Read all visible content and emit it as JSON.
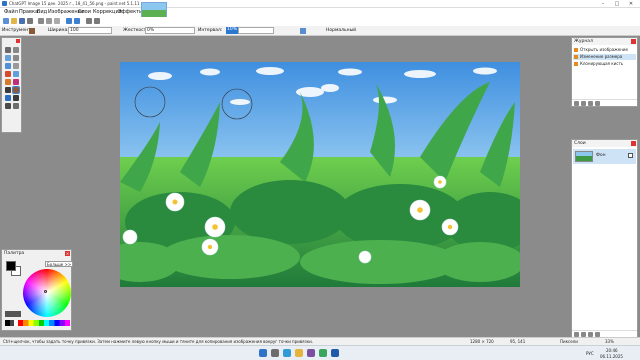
{
  "window": {
    "title": "ChatGPT Image 15 дек. 2025 г., 18_41_56.png - paint.net 5.1.11"
  },
  "menu": {
    "file": "Файл",
    "edit": "Правка",
    "view": "Вид",
    "image": "Изображение",
    "layers": "Слои",
    "adjustments": "Коррекция",
    "effects": "Эффекты"
  },
  "options": {
    "tool_label": "Инструмент:",
    "width_label": "Ширина:",
    "width_value": "100",
    "hardness_label": "Жесткость:",
    "hardness_value": "0%",
    "interval_label": "Интервал:",
    "interval_value": "10%",
    "blend_mode": "Нормальный"
  },
  "palette": {
    "title": "Палитра",
    "more_button": "Больше >>",
    "primary_color": "#000000",
    "secondary_color": "#ffffff"
  },
  "history": {
    "title": "Журнал",
    "items": [
      {
        "label": "Открыть изображение",
        "selected": false
      },
      {
        "label": "Изменение размера",
        "selected": true
      },
      {
        "label": "Клонирующая кисть",
        "selected": false
      }
    ]
  },
  "layers": {
    "title": "Слои",
    "items": [
      {
        "name": "Фон",
        "visible": true
      }
    ]
  },
  "status": {
    "hint": "Ctrl+щелчок, чтобы задать точку привязки. Затем нажмите левую кнопку мыши и тяните для копирования изображения вокруг точки привязки.",
    "image_size": "1280 × 720",
    "cursor_pos": "95, 141",
    "units": "Пиксели",
    "zoom": "33%"
  },
  "taskbar": {
    "lang": "РУС",
    "time": "20:46",
    "date": "06.11.2025"
  },
  "icons": [
    "app-icon",
    "minimize-icon",
    "maximize-icon",
    "close-icon",
    "new-icon",
    "open-icon",
    "save-icon",
    "print-icon",
    "cut-icon",
    "copy-icon",
    "paste-icon",
    "undo-icon",
    "redo-icon",
    "grid-icon",
    "settings-icon",
    "clone-stamp-icon",
    "brush-icon",
    "eraser-icon",
    "bucket-icon",
    "gradient-icon",
    "text-icon",
    "windows-start-icon",
    "search-icon",
    "edge-icon",
    "explorer-icon",
    "paintnet-icon"
  ],
  "accent_color": "#2b78d0"
}
